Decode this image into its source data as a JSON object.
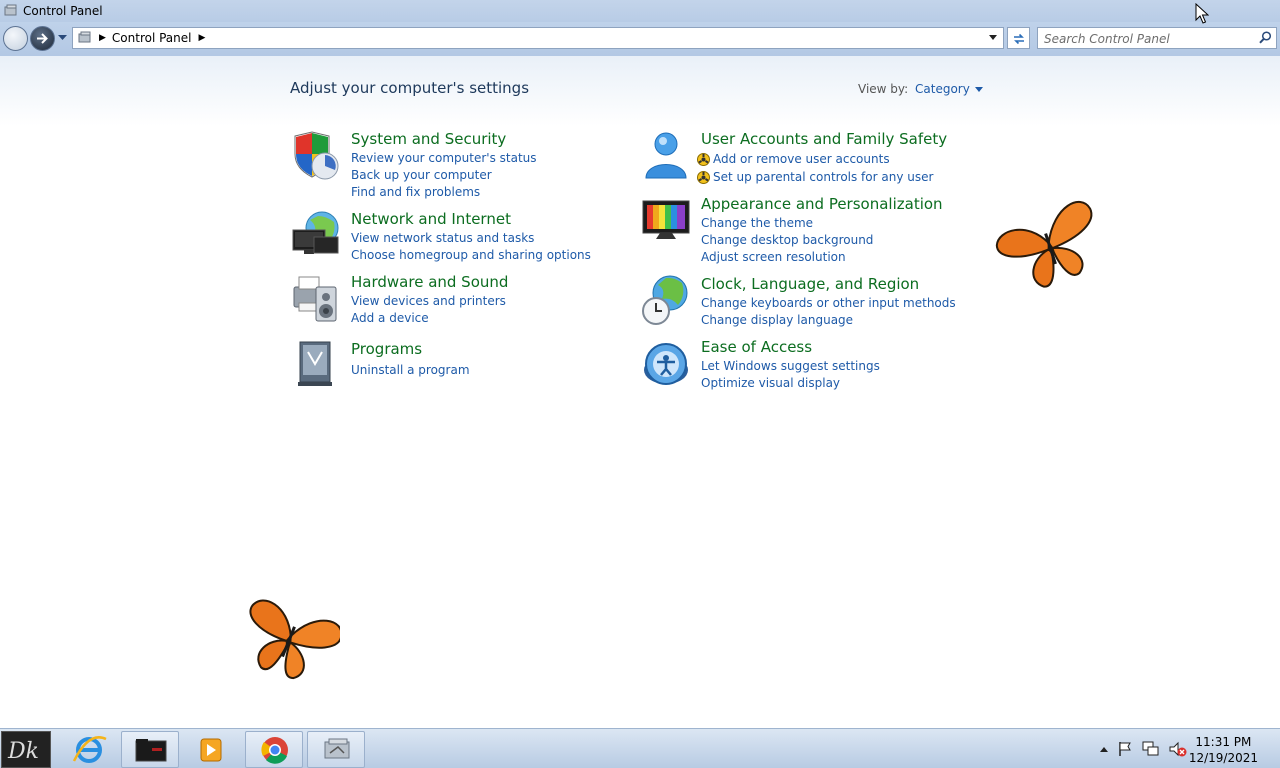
{
  "window": {
    "title": "Control Panel"
  },
  "address_bar": {
    "crumbs": [
      "Control Panel"
    ]
  },
  "search": {
    "placeholder": "Search Control Panel"
  },
  "header": {
    "title": "Adjust your computer's settings",
    "view_by_label": "View by:",
    "view_by_value": "Category"
  },
  "categories": [
    {
      "title": "System and Security",
      "icon": "shield-icon",
      "links": [
        "Review your computer's status",
        "Back up your computer",
        "Find and fix problems"
      ]
    },
    {
      "title": "Network and Internet",
      "icon": "network-globe-icon",
      "links": [
        "View network status and tasks",
        "Choose homegroup and sharing options"
      ]
    },
    {
      "title": "Hardware and Sound",
      "icon": "printer-speaker-icon",
      "links": [
        "View devices and printers",
        "Add a device"
      ]
    },
    {
      "title": "Programs",
      "icon": "programs-icon",
      "links": [
        "Uninstall a program"
      ]
    },
    {
      "title": "User Accounts and Family Safety",
      "icon": "user-icon",
      "links": [
        "Add or remove user accounts",
        "Set up parental controls for any user"
      ]
    },
    {
      "title": "Appearance and Personalization",
      "icon": "monitor-icon",
      "links": [
        "Change the theme",
        "Change desktop background",
        "Adjust screen resolution"
      ]
    },
    {
      "title": "Clock, Language, and Region",
      "icon": "clock-globe-icon",
      "links": [
        "Change keyboards or other input methods",
        "Change display language"
      ]
    },
    {
      "title": "Ease of Access",
      "icon": "ease-of-access-icon",
      "links": [
        "Let Windows suggest settings",
        "Optimize visual display"
      ]
    }
  ],
  "taskbar": {
    "items": [
      "start-logo",
      "internet-explorer",
      "file-explorer",
      "media-player",
      "chrome",
      "control-panel"
    ],
    "clock_time": "11:31 PM",
    "clock_date": "12/19/2021"
  },
  "colors": {
    "category_title": "#0c6d20",
    "link": "#1e5aa8",
    "heading": "#1e395b"
  }
}
